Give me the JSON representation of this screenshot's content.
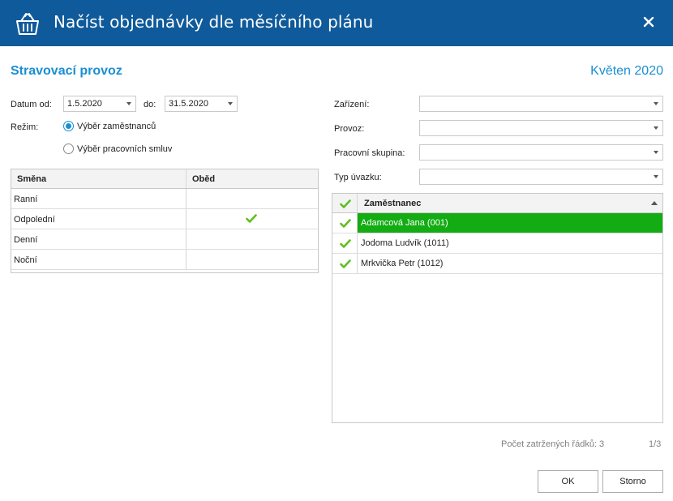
{
  "window": {
    "title": "Načíst objednávky dle měsíčního plánu"
  },
  "header": {
    "section_title": "Stravovací provoz",
    "month": "Květen 2020"
  },
  "filters": {
    "date_from_label": "Datum od:",
    "date_from": "1.5.2020",
    "date_to_label": "do:",
    "date_to": "31.5.2020",
    "mode_label": "Režim:",
    "mode_options": [
      {
        "label": "Výběr zaměstnanců",
        "checked": true
      },
      {
        "label": "Výběr pracovních smluv",
        "checked": false
      }
    ]
  },
  "right_filters": [
    {
      "label": "Zařízení:",
      "value": ""
    },
    {
      "label": "Provoz:",
      "value": ""
    },
    {
      "label": "Pracovní skupina:",
      "value": ""
    },
    {
      "label": "Typ úvazku:",
      "value": ""
    }
  ],
  "shifts_table": {
    "columns": [
      "Směna",
      "Oběd"
    ],
    "rows": [
      {
        "name": "Ranní",
        "lunch": false
      },
      {
        "name": "Odpolední",
        "lunch": true
      },
      {
        "name": "Denní",
        "lunch": false
      },
      {
        "name": "Noční",
        "lunch": false
      }
    ]
  },
  "employees_table": {
    "column": "Zaměstnanec",
    "rows": [
      {
        "name": "Adamcová Jana (001)",
        "checked": true,
        "selected": true
      },
      {
        "name": "Jodoma Ludvík (1011)",
        "checked": true,
        "selected": false
      },
      {
        "name": "Mrkvička Petr (1012)",
        "checked": true,
        "selected": false
      }
    ]
  },
  "status": {
    "checked_rows": "Počet zatržených řádků: 3",
    "page": "1/3"
  },
  "buttons": {
    "ok": "OK",
    "cancel": "Storno"
  },
  "colors": {
    "titlebar": "#0f5a9a",
    "accent": "#1a8fd3",
    "check": "#5fbf1f",
    "selected_row": "#13ac13"
  },
  "icons": {
    "app": "basket-icon",
    "close": "close-icon",
    "check": "checkmark-icon"
  }
}
